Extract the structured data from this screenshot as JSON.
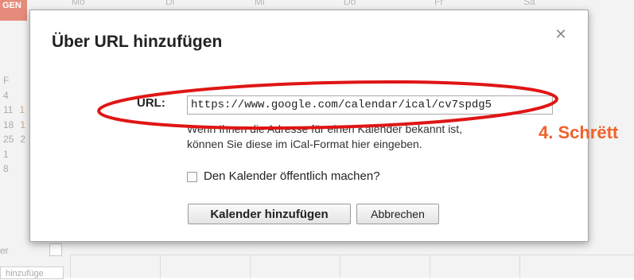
{
  "background": {
    "badge": "GEN",
    "day_names": [
      "Mo",
      "Di",
      "Mi",
      "Do",
      "Fr",
      "Sa"
    ],
    "mini_calendar_header": "F",
    "mini_calendar_rows": [
      [
        "4"
      ],
      [
        "11",
        "1"
      ],
      [
        "18",
        "1"
      ],
      [
        "25",
        "2"
      ],
      [
        "1"
      ],
      [
        "8"
      ]
    ],
    "side_label": "er",
    "side_input": "hinzufüge"
  },
  "dialog": {
    "title": "Über URL hinzufügen",
    "close_icon": "close-icon",
    "url_label": "URL:",
    "url_value": "https://www.google.com/calendar/ical/cv7spdg5",
    "helper_line1": "Wenn Ihnen die Adresse für einen Kalender bekannt ist,",
    "helper_line2": "können Sie diese im iCal-Format hier eingeben.",
    "public_checkbox_label": "Den Kalender öffentlich machen?",
    "public_checked": false,
    "add_button": "Kalender hinzufügen",
    "cancel_button": "Abbrechen"
  },
  "annotation": {
    "step_label": "4. Schrëtt",
    "color": "#e01515",
    "label_color": "#f0622a"
  }
}
